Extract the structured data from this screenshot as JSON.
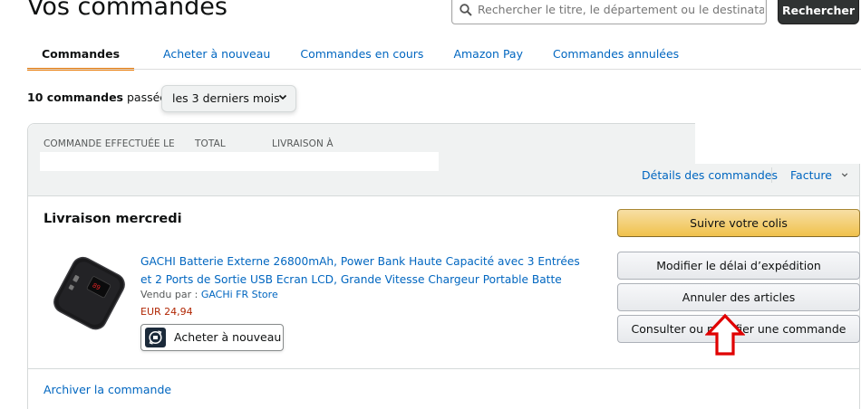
{
  "page_title": "Vos commandes",
  "search": {
    "placeholder": "Rechercher le titre, le département ou le destinataire",
    "button_label": "Rechercher"
  },
  "tabs": [
    {
      "label": "Commandes",
      "active": true
    },
    {
      "label": "Acheter à nouveau",
      "active": false
    },
    {
      "label": "Commandes en cours",
      "active": false
    },
    {
      "label": "Amazon Pay",
      "active": false
    },
    {
      "label": "Commandes annulées",
      "active": false
    }
  ],
  "filter": {
    "count_bold": "10 commandes",
    "count_suffix": " passées",
    "period_selected": "les 3 derniers mois"
  },
  "order": {
    "header": {
      "label_date": "COMMANDE EFFECTUÉE LE",
      "label_total": "TOTAL",
      "label_delivery": "LIVRAISON À",
      "link_details": "Détails des commandes",
      "link_invoice": "Facture"
    },
    "delivery_title": "Livraison mercredi",
    "product": {
      "title": "GACHI Batterie Externe 26800mAh, Power Bank Haute Capacité avec 3 Entrées et 2 Ports de Sortie USB Ecran LCD, Grande Vitesse Chargeur Portable Batte",
      "sold_by_label": "Vendu par : ",
      "seller": "GACHi FR Store",
      "price": "EUR 24,94",
      "buy_again_label": "Acheter à nouveau"
    },
    "actions": {
      "track": "Suivre votre colis",
      "change_delivery": "Modifier le délai d’expédition",
      "cancel": "Annuler des articles",
      "view": "Consulter ou modifier une commande"
    },
    "archive_link": "Archiver la commande"
  },
  "colors": {
    "accent_tab": "#e77600",
    "link": "#0066c0",
    "price": "#b12704",
    "primary_button": "#f0c14b",
    "annotation_arrow": "#e00000"
  }
}
